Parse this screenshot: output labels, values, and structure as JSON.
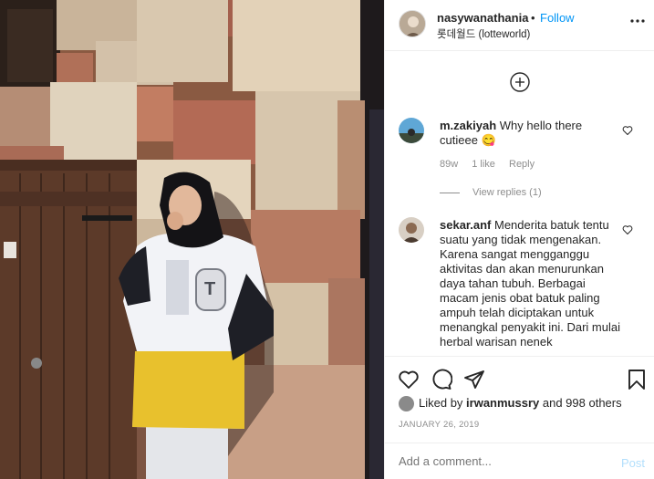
{
  "post": {
    "author": "nasywanathania",
    "separator": "•",
    "follow_label": "Follow",
    "location": "롯데월드 (lotteworld)"
  },
  "comments": [
    {
      "username": "m.zakiyah",
      "text": "Why hello there cutieee 😋",
      "time": "89w",
      "likes": "1 like",
      "reply_label": "Reply",
      "view_replies": "View replies (1)"
    },
    {
      "username": "sekar.anf",
      "text": "Menderita batuk tentu suatu yang tidak mengenakan. Karena sangat mengganggu aktivitas dan akan menurunkan daya tahan tubuh. Berbagai macam jenis obat batuk paling ampuh telah diciptakan untuk menangkal penyakit ini. Dari mulai herbal warisan nenek"
    }
  ],
  "likes": {
    "prefix": "Liked by",
    "user": "irwanmussry",
    "suffix": "and 998 others"
  },
  "date": "JANUARY 26, 2019",
  "add_comment": {
    "placeholder": "Add a comment...",
    "post_label": "Post"
  },
  "icons": [
    "more-options-icon",
    "add-circle-icon",
    "heart-icon",
    "comment-icon",
    "share-icon",
    "bookmark-icon"
  ],
  "colors": {
    "link": "#0095f6",
    "post_disabled": "#b2dffc",
    "muted": "#8e8e8e",
    "border": "#efefef"
  }
}
